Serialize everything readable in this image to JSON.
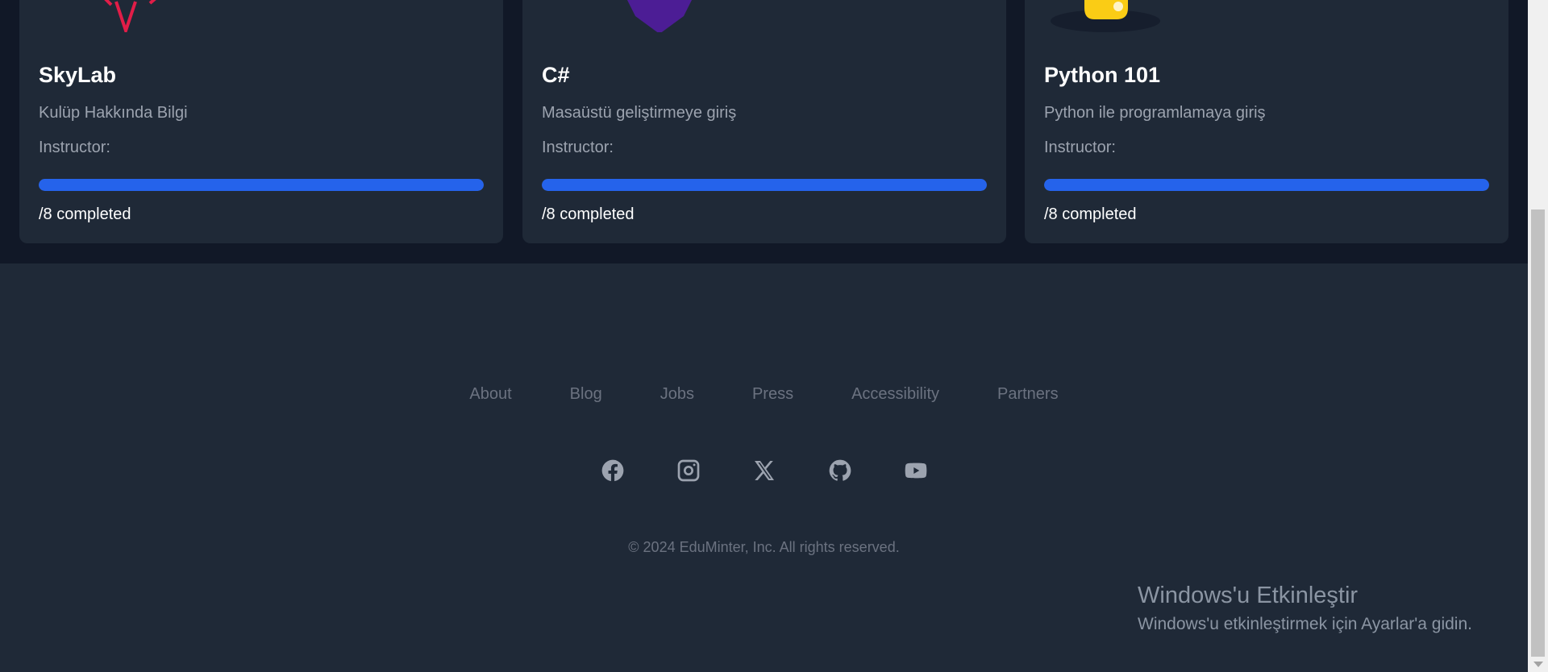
{
  "courses": [
    {
      "title": "SkyLab",
      "description": "Kulüp Hakkında Bilgi",
      "instructor_label": "Instructor:",
      "progress_fraction": 1.0,
      "completed_text": "/8 completed",
      "logo_icon": "skylab-logo-icon",
      "accent": "#e11d48"
    },
    {
      "title": "C#",
      "description": "Masaüstü geliştirmeye giriş",
      "instructor_label": "Instructor:",
      "progress_fraction": 1.0,
      "completed_text": "/8 completed",
      "logo_icon": "csharp-logo-icon",
      "accent": "#5b21b6"
    },
    {
      "title": "Python 101",
      "description": "Python ile programlamaya giriş",
      "instructor_label": "Instructor:",
      "progress_fraction": 1.0,
      "completed_text": "/8 completed",
      "logo_icon": "python-logo-icon",
      "accent": "#facc15"
    }
  ],
  "footer": {
    "nav": [
      "About",
      "Blog",
      "Jobs",
      "Press",
      "Accessibility",
      "Partners"
    ],
    "social_icons": [
      "facebook-icon",
      "instagram-icon",
      "x-icon",
      "github-icon",
      "youtube-icon"
    ],
    "copyright": "© 2024 EduMinter, Inc. All rights reserved."
  },
  "watermark": {
    "title": "Windows'u Etkinleştir",
    "subtitle": "Windows'u etkinleştirmek için Ayarlar'a gidin."
  },
  "colors": {
    "page_bg": "#1f2937",
    "section_bg": "#111827",
    "card_bg": "#1f2937",
    "progress": "#2563eb"
  }
}
